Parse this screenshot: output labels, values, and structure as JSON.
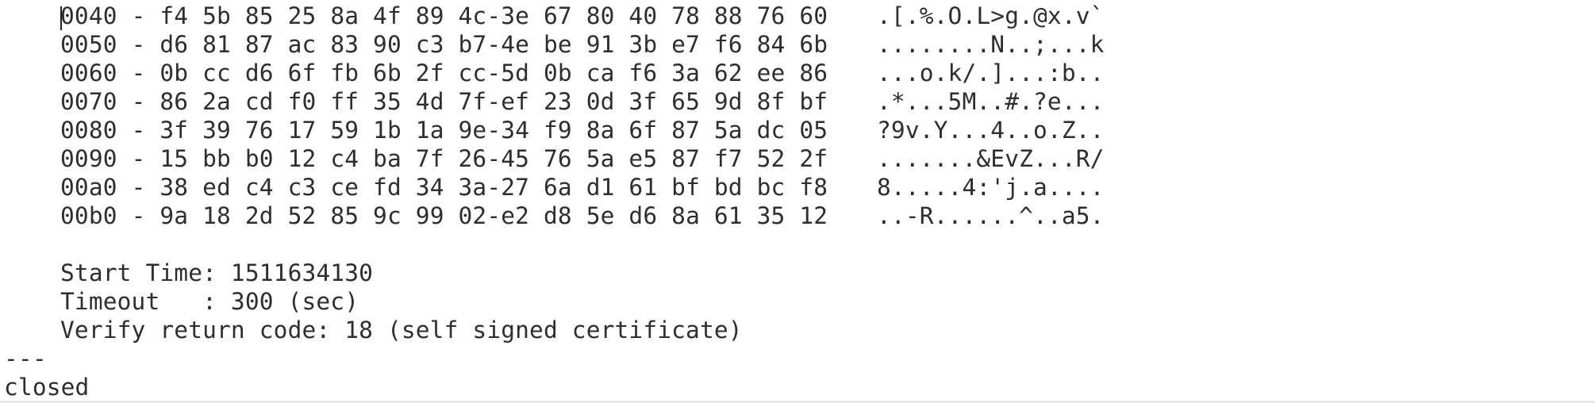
{
  "hexdump": [
    {
      "offset": "0040",
      "sep": " - ",
      "bytes": "f4 5b 85 25 8a 4f 89 4c-3e 67 80 40 78 88 76 60",
      "ascii": ".[.%.O.L>g.@x.v`"
    },
    {
      "offset": "0050",
      "sep": " - ",
      "bytes": "d6 81 87 ac 83 90 c3 b7-4e be 91 3b e7 f6 84 6b",
      "ascii": "........N..;...k"
    },
    {
      "offset": "0060",
      "sep": " - ",
      "bytes": "0b cc d6 6f fb 6b 2f cc-5d 0b ca f6 3a 62 ee 86",
      "ascii": "...o.k/.]...:b.."
    },
    {
      "offset": "0070",
      "sep": " - ",
      "bytes": "86 2a cd f0 ff 35 4d 7f-ef 23 0d 3f 65 9d 8f bf",
      "ascii": ".*...5M..#.?e..."
    },
    {
      "offset": "0080",
      "sep": " - ",
      "bytes": "3f 39 76 17 59 1b 1a 9e-34 f9 8a 6f 87 5a dc 05",
      "ascii": "?9v.Y...4..o.Z.."
    },
    {
      "offset": "0090",
      "sep": " - ",
      "bytes": "15 bb b0 12 c4 ba 7f 26-45 76 5a e5 87 f7 52 2f",
      "ascii": ".......&EvZ...R/"
    },
    {
      "offset": "00a0",
      "sep": " - ",
      "bytes": "38 ed c4 c3 ce fd 34 3a-27 6a d1 61 bf bd bc f8",
      "ascii": "8.....4:'j.a...."
    },
    {
      "offset": "00b0",
      "sep": " - ",
      "bytes": "9a 18 2d 52 85 9c 99 02-e2 d8 5e d6 8a 61 35 12",
      "ascii": "..-R......^..a5."
    }
  ],
  "session": {
    "start_time": "Start Time: 1511634130",
    "timeout": "Timeout   : 300 (sec)",
    "verify_return_code": "Verify return code: 18 (self signed certificate)"
  },
  "separator": "---",
  "status": "closed",
  "colors": {
    "background": "#ffffff",
    "text": "#2e2e2e"
  }
}
